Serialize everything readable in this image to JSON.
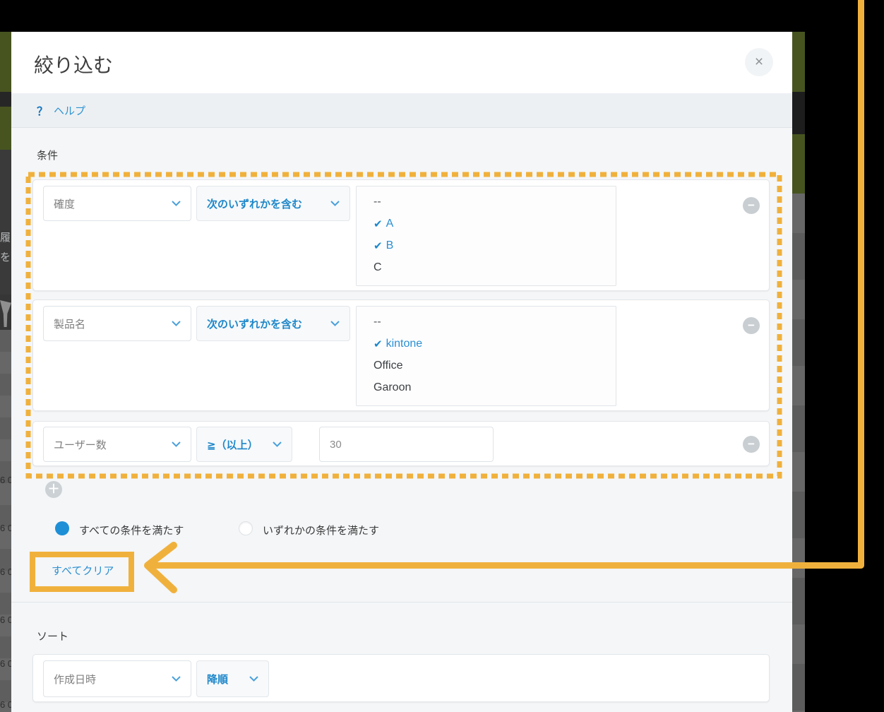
{
  "colors": {
    "annotation_orange": "#F0B13C",
    "accent_blue": "#1E87C9",
    "link_blue": "#2F8FD0",
    "radio_selected_blue": "#1D8FD6",
    "modal_content_bg": "#F4F6F8",
    "help_bar_bg": "#EDF0F3",
    "backdrop_olive": "#475420"
  },
  "backdrop": {
    "fragment_char_1": "履",
    "fragment_char_2": "を",
    "row_fragment_text": "6 0"
  },
  "modal": {
    "title": "絞り込む",
    "close_glyph": "×",
    "help": {
      "icon_glyph": "？",
      "label": "ヘルプ"
    },
    "conditions": {
      "section_label": "条件",
      "check_glyph": "✔",
      "add_glyph": "＋",
      "remove_glyph": "−",
      "rows": [
        {
          "field": "確度",
          "operator": "次のいずれかを含む",
          "options": [
            {
              "label": "--"
            },
            {
              "label": "A",
              "checked": true
            },
            {
              "label": "B",
              "checked": true
            },
            {
              "label": "C"
            }
          ]
        },
        {
          "field": "製品名",
          "operator": "次のいずれかを含む",
          "options": [
            {
              "label": "--"
            },
            {
              "label": "kintone",
              "checked": true
            },
            {
              "label": "Office"
            },
            {
              "label": "Garoon"
            }
          ]
        },
        {
          "field": "ユーザー数",
          "operator": "≧（以上）",
          "value": "30"
        }
      ],
      "match_all_label": "すべての条件を満たす",
      "match_any_label": "いずれかの条件を満たす",
      "clear_all_label": "すべてクリア"
    },
    "sort": {
      "section_label": "ソート",
      "field": "作成日時",
      "order": "降順"
    }
  }
}
